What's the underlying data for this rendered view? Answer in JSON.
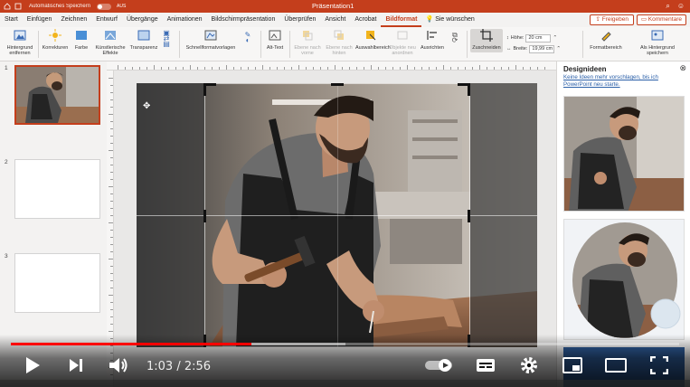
{
  "titlebar": {
    "autosave_label": "Automatisches Speichern",
    "autosave_state": "AUS",
    "doc_title": "Präsentation1"
  },
  "tabs": [
    {
      "label": "Start"
    },
    {
      "label": "Einfügen"
    },
    {
      "label": "Zeichnen"
    },
    {
      "label": "Entwurf"
    },
    {
      "label": "Übergänge"
    },
    {
      "label": "Animationen"
    },
    {
      "label": "Bildschirmpräsentation"
    },
    {
      "label": "Überprüfen"
    },
    {
      "label": "Ansicht"
    },
    {
      "label": "Acrobat"
    },
    {
      "label": "Bildformat"
    }
  ],
  "tell_me": "Sie wünschen",
  "share_label": "Freigeben",
  "comments_label": "Kommentare",
  "ribbon": {
    "remove_bg": "Hintergrund entfernen",
    "corrections": "Korrekturen",
    "color": "Farbe",
    "artistic": "Künstlerische Effekte",
    "transparency": "Transparenz",
    "quick_styles": "Schnellformatvorlagen",
    "alt_text": "Alt-Text",
    "bring_forward": "Ebene nach vorne",
    "send_backward": "Ebene nach hinten",
    "selection_pane": "Auswahlbereich",
    "align_objects": "Objekte neu anordnen",
    "align": "Ausrichten",
    "crop": "Zuschneiden",
    "height_label": "Höhe:",
    "height_value": "20 cm",
    "width_label": "Breite:",
    "width_value": "19,99 cm",
    "format_pane": "Formatbereich",
    "save_as_bg": "Als Hintergrund speichern"
  },
  "slides": [
    {
      "num": "1"
    },
    {
      "num": "2"
    },
    {
      "num": "3"
    }
  ],
  "design_pane": {
    "title": "Designideen",
    "hint": "Keine Ideen mehr vorschlagen, bis ich PowerPoint neu starte."
  },
  "player": {
    "current": "1:03",
    "total": "2:56",
    "progress": 0.36
  }
}
